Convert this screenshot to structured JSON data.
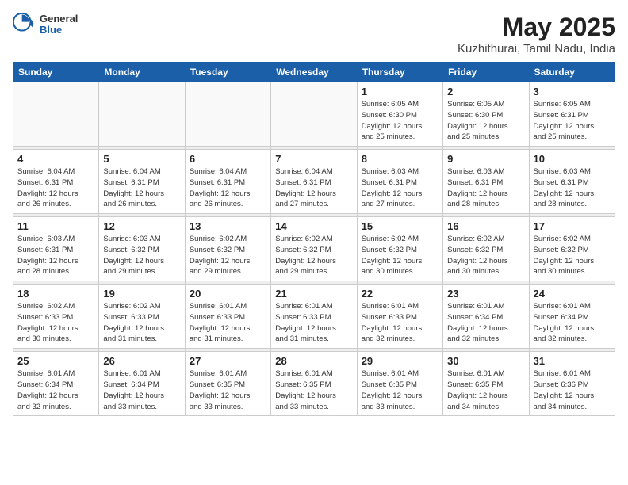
{
  "header": {
    "logo_general": "General",
    "logo_blue": "Blue",
    "title": "May 2025",
    "location": "Kuzhithurai, Tamil Nadu, India"
  },
  "weekdays": [
    "Sunday",
    "Monday",
    "Tuesday",
    "Wednesday",
    "Thursday",
    "Friday",
    "Saturday"
  ],
  "weeks": [
    [
      {
        "day": "",
        "info": ""
      },
      {
        "day": "",
        "info": ""
      },
      {
        "day": "",
        "info": ""
      },
      {
        "day": "",
        "info": ""
      },
      {
        "day": "1",
        "info": "Sunrise: 6:05 AM\nSunset: 6:30 PM\nDaylight: 12 hours\nand 25 minutes."
      },
      {
        "day": "2",
        "info": "Sunrise: 6:05 AM\nSunset: 6:30 PM\nDaylight: 12 hours\nand 25 minutes."
      },
      {
        "day": "3",
        "info": "Sunrise: 6:05 AM\nSunset: 6:31 PM\nDaylight: 12 hours\nand 25 minutes."
      }
    ],
    [
      {
        "day": "4",
        "info": "Sunrise: 6:04 AM\nSunset: 6:31 PM\nDaylight: 12 hours\nand 26 minutes."
      },
      {
        "day": "5",
        "info": "Sunrise: 6:04 AM\nSunset: 6:31 PM\nDaylight: 12 hours\nand 26 minutes."
      },
      {
        "day": "6",
        "info": "Sunrise: 6:04 AM\nSunset: 6:31 PM\nDaylight: 12 hours\nand 26 minutes."
      },
      {
        "day": "7",
        "info": "Sunrise: 6:04 AM\nSunset: 6:31 PM\nDaylight: 12 hours\nand 27 minutes."
      },
      {
        "day": "8",
        "info": "Sunrise: 6:03 AM\nSunset: 6:31 PM\nDaylight: 12 hours\nand 27 minutes."
      },
      {
        "day": "9",
        "info": "Sunrise: 6:03 AM\nSunset: 6:31 PM\nDaylight: 12 hours\nand 28 minutes."
      },
      {
        "day": "10",
        "info": "Sunrise: 6:03 AM\nSunset: 6:31 PM\nDaylight: 12 hours\nand 28 minutes."
      }
    ],
    [
      {
        "day": "11",
        "info": "Sunrise: 6:03 AM\nSunset: 6:31 PM\nDaylight: 12 hours\nand 28 minutes."
      },
      {
        "day": "12",
        "info": "Sunrise: 6:03 AM\nSunset: 6:32 PM\nDaylight: 12 hours\nand 29 minutes."
      },
      {
        "day": "13",
        "info": "Sunrise: 6:02 AM\nSunset: 6:32 PM\nDaylight: 12 hours\nand 29 minutes."
      },
      {
        "day": "14",
        "info": "Sunrise: 6:02 AM\nSunset: 6:32 PM\nDaylight: 12 hours\nand 29 minutes."
      },
      {
        "day": "15",
        "info": "Sunrise: 6:02 AM\nSunset: 6:32 PM\nDaylight: 12 hours\nand 30 minutes."
      },
      {
        "day": "16",
        "info": "Sunrise: 6:02 AM\nSunset: 6:32 PM\nDaylight: 12 hours\nand 30 minutes."
      },
      {
        "day": "17",
        "info": "Sunrise: 6:02 AM\nSunset: 6:32 PM\nDaylight: 12 hours\nand 30 minutes."
      }
    ],
    [
      {
        "day": "18",
        "info": "Sunrise: 6:02 AM\nSunset: 6:33 PM\nDaylight: 12 hours\nand 30 minutes."
      },
      {
        "day": "19",
        "info": "Sunrise: 6:02 AM\nSunset: 6:33 PM\nDaylight: 12 hours\nand 31 minutes."
      },
      {
        "day": "20",
        "info": "Sunrise: 6:01 AM\nSunset: 6:33 PM\nDaylight: 12 hours\nand 31 minutes."
      },
      {
        "day": "21",
        "info": "Sunrise: 6:01 AM\nSunset: 6:33 PM\nDaylight: 12 hours\nand 31 minutes."
      },
      {
        "day": "22",
        "info": "Sunrise: 6:01 AM\nSunset: 6:33 PM\nDaylight: 12 hours\nand 32 minutes."
      },
      {
        "day": "23",
        "info": "Sunrise: 6:01 AM\nSunset: 6:34 PM\nDaylight: 12 hours\nand 32 minutes."
      },
      {
        "day": "24",
        "info": "Sunrise: 6:01 AM\nSunset: 6:34 PM\nDaylight: 12 hours\nand 32 minutes."
      }
    ],
    [
      {
        "day": "25",
        "info": "Sunrise: 6:01 AM\nSunset: 6:34 PM\nDaylight: 12 hours\nand 32 minutes."
      },
      {
        "day": "26",
        "info": "Sunrise: 6:01 AM\nSunset: 6:34 PM\nDaylight: 12 hours\nand 33 minutes."
      },
      {
        "day": "27",
        "info": "Sunrise: 6:01 AM\nSunset: 6:35 PM\nDaylight: 12 hours\nand 33 minutes."
      },
      {
        "day": "28",
        "info": "Sunrise: 6:01 AM\nSunset: 6:35 PM\nDaylight: 12 hours\nand 33 minutes."
      },
      {
        "day": "29",
        "info": "Sunrise: 6:01 AM\nSunset: 6:35 PM\nDaylight: 12 hours\nand 33 minutes."
      },
      {
        "day": "30",
        "info": "Sunrise: 6:01 AM\nSunset: 6:35 PM\nDaylight: 12 hours\nand 34 minutes."
      },
      {
        "day": "31",
        "info": "Sunrise: 6:01 AM\nSunset: 6:36 PM\nDaylight: 12 hours\nand 34 minutes."
      }
    ]
  ]
}
